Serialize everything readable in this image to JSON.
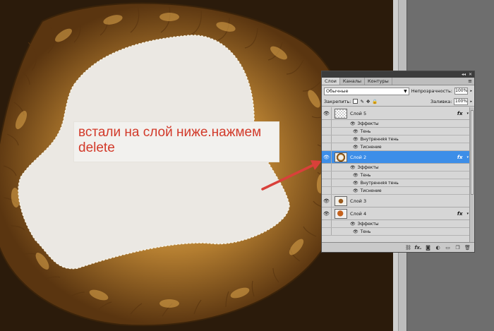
{
  "annotation": {
    "line1": "встали на слой ниже.нажмем",
    "line2": "delete"
  },
  "panel": {
    "tabs": [
      "Слои",
      "Каналы",
      "Контуры"
    ],
    "active_tab": "Слои",
    "blend_mode": "Обычные",
    "opacity_label": "Непрозрачность:",
    "opacity_value": "100%",
    "lock_label": "Закрепить:",
    "fill_label": "Заливка:",
    "fill_value": "100%",
    "effects_label": "Эффекты",
    "fx_label": "fx",
    "layers": [
      {
        "name": "Слой 5",
        "selected": false
      },
      {
        "name": "Слой 2",
        "selected": true
      },
      {
        "name": "Слой 3",
        "selected": false
      },
      {
        "name": "Слой 4",
        "selected": false
      }
    ],
    "effects": {
      "shadow": "Тень",
      "inner_shadow": "Внутренняя тень",
      "emboss": "Тиснение"
    },
    "partial_effect": "Тень"
  },
  "colors": {
    "selection": "#3d8ee8",
    "annotation_text": "#d23a2a",
    "arrow": "#d9403a",
    "canvas_bg": "#2b1b0b",
    "ring": "#b37d30"
  }
}
